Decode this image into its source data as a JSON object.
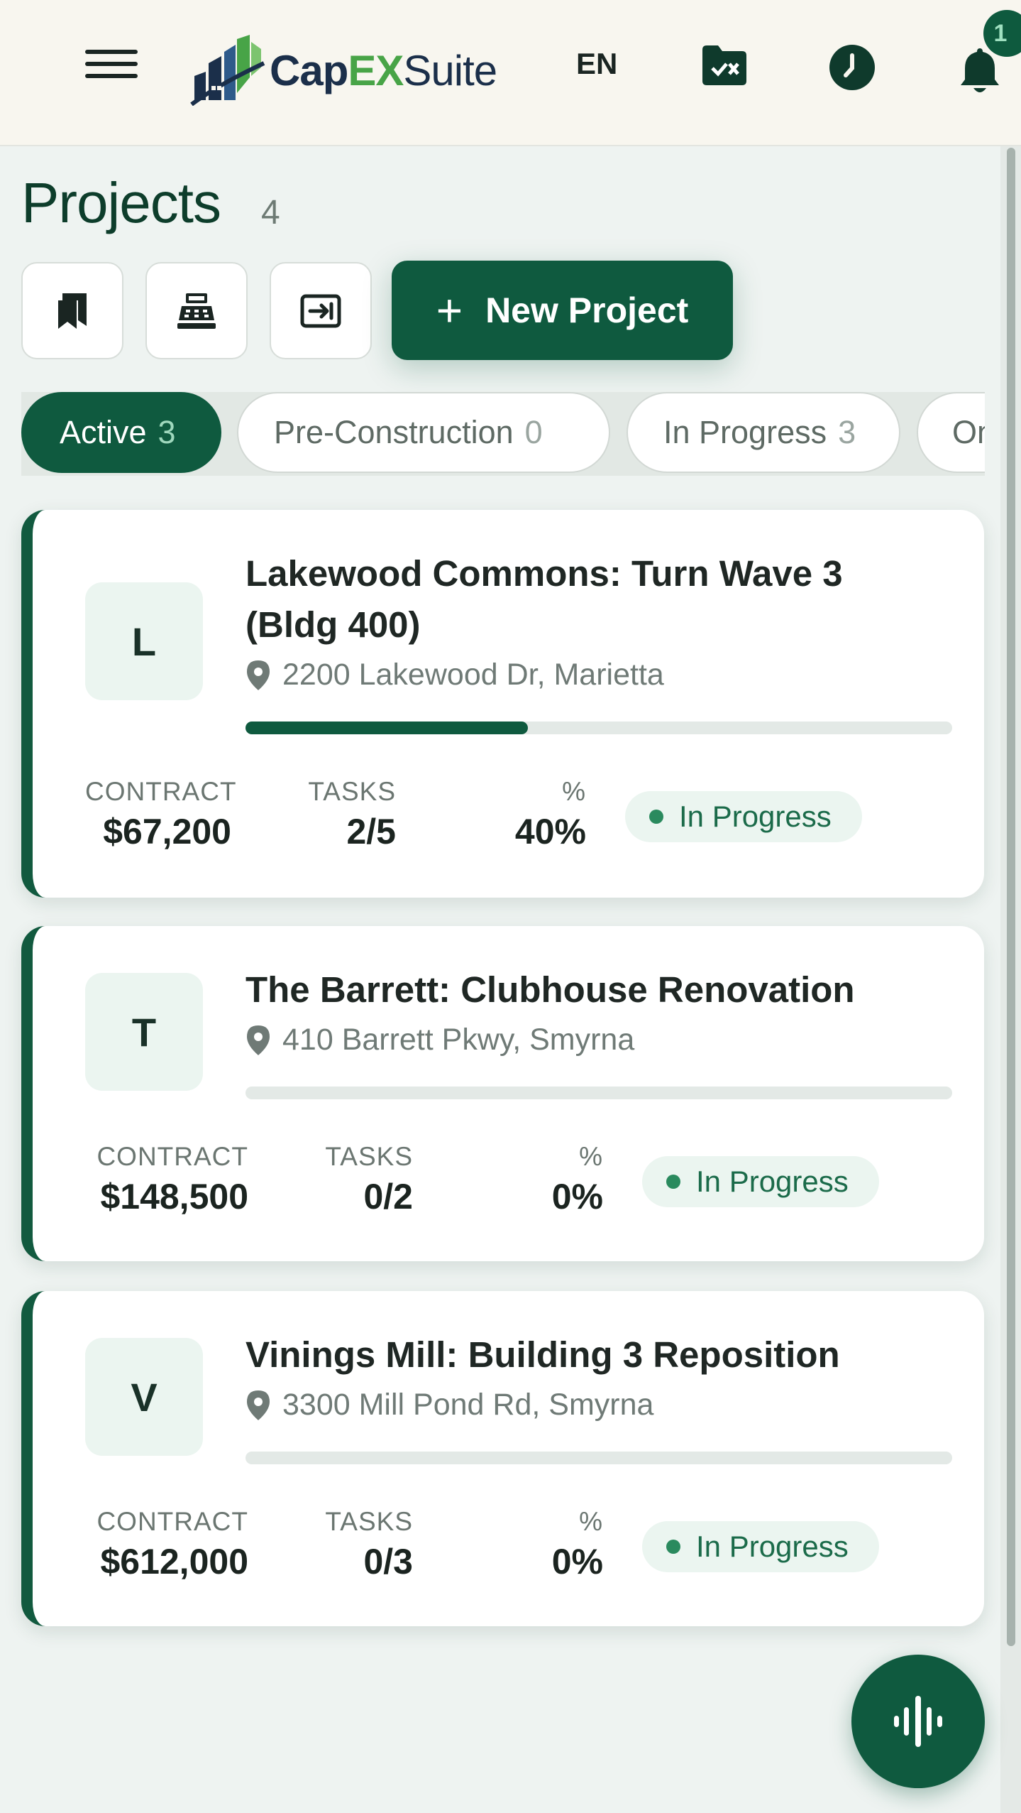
{
  "header": {
    "logo": {
      "part1": "Cap",
      "part2": "EX",
      "part3": "Suite"
    },
    "language": "EN",
    "notification_count": "1",
    "icons": [
      "menu-icon",
      "folder-check-icon",
      "clock-icon",
      "bell-icon"
    ]
  },
  "page": {
    "title": "Projects",
    "count": "4"
  },
  "actions": {
    "new_project_label": "New Project",
    "icons": [
      "bookmark-icon",
      "register-icon",
      "import-icon"
    ]
  },
  "filters": [
    {
      "label": "Active",
      "count": "3",
      "active": true
    },
    {
      "label": "Pre-Construction",
      "count": "0",
      "active": false
    },
    {
      "label": "In Progress",
      "count": "3",
      "active": false
    },
    {
      "label": "On",
      "count": "",
      "active": false
    }
  ],
  "stat_labels": {
    "contract": "CONTRACT",
    "tasks": "TASKS",
    "percent": "%"
  },
  "projects": [
    {
      "initial": "L",
      "name": "Lakewood Commons: Turn Wave 3 (Bldg 400)",
      "address": "2200 Lakewood Dr, Marietta",
      "progress": 0.4,
      "contract": "$67,200",
      "tasks": "2/5",
      "percent": "40%",
      "status": "In Progress"
    },
    {
      "initial": "T",
      "name": "The Barrett: Clubhouse Renovation",
      "address": "410 Barrett Pkwy, Smyrna",
      "progress": 0,
      "contract": "$148,500",
      "tasks": "0/2",
      "percent": "0%",
      "status": "In Progress"
    },
    {
      "initial": "V",
      "name": "Vinings Mill: Building 3 Reposition",
      "address": "3300 Mill Pond Rd, Smyrna",
      "progress": 0,
      "contract": "$612,000",
      "tasks": "0/3",
      "percent": "0%",
      "status": "In Progress"
    }
  ],
  "colors": {
    "brand": "#0f5a3f",
    "accent_green": "#48a447",
    "logo_navy": "#1b2f4a",
    "status_bg": "#ebf5f0"
  },
  "fab_icon": "voice-waveform-icon"
}
